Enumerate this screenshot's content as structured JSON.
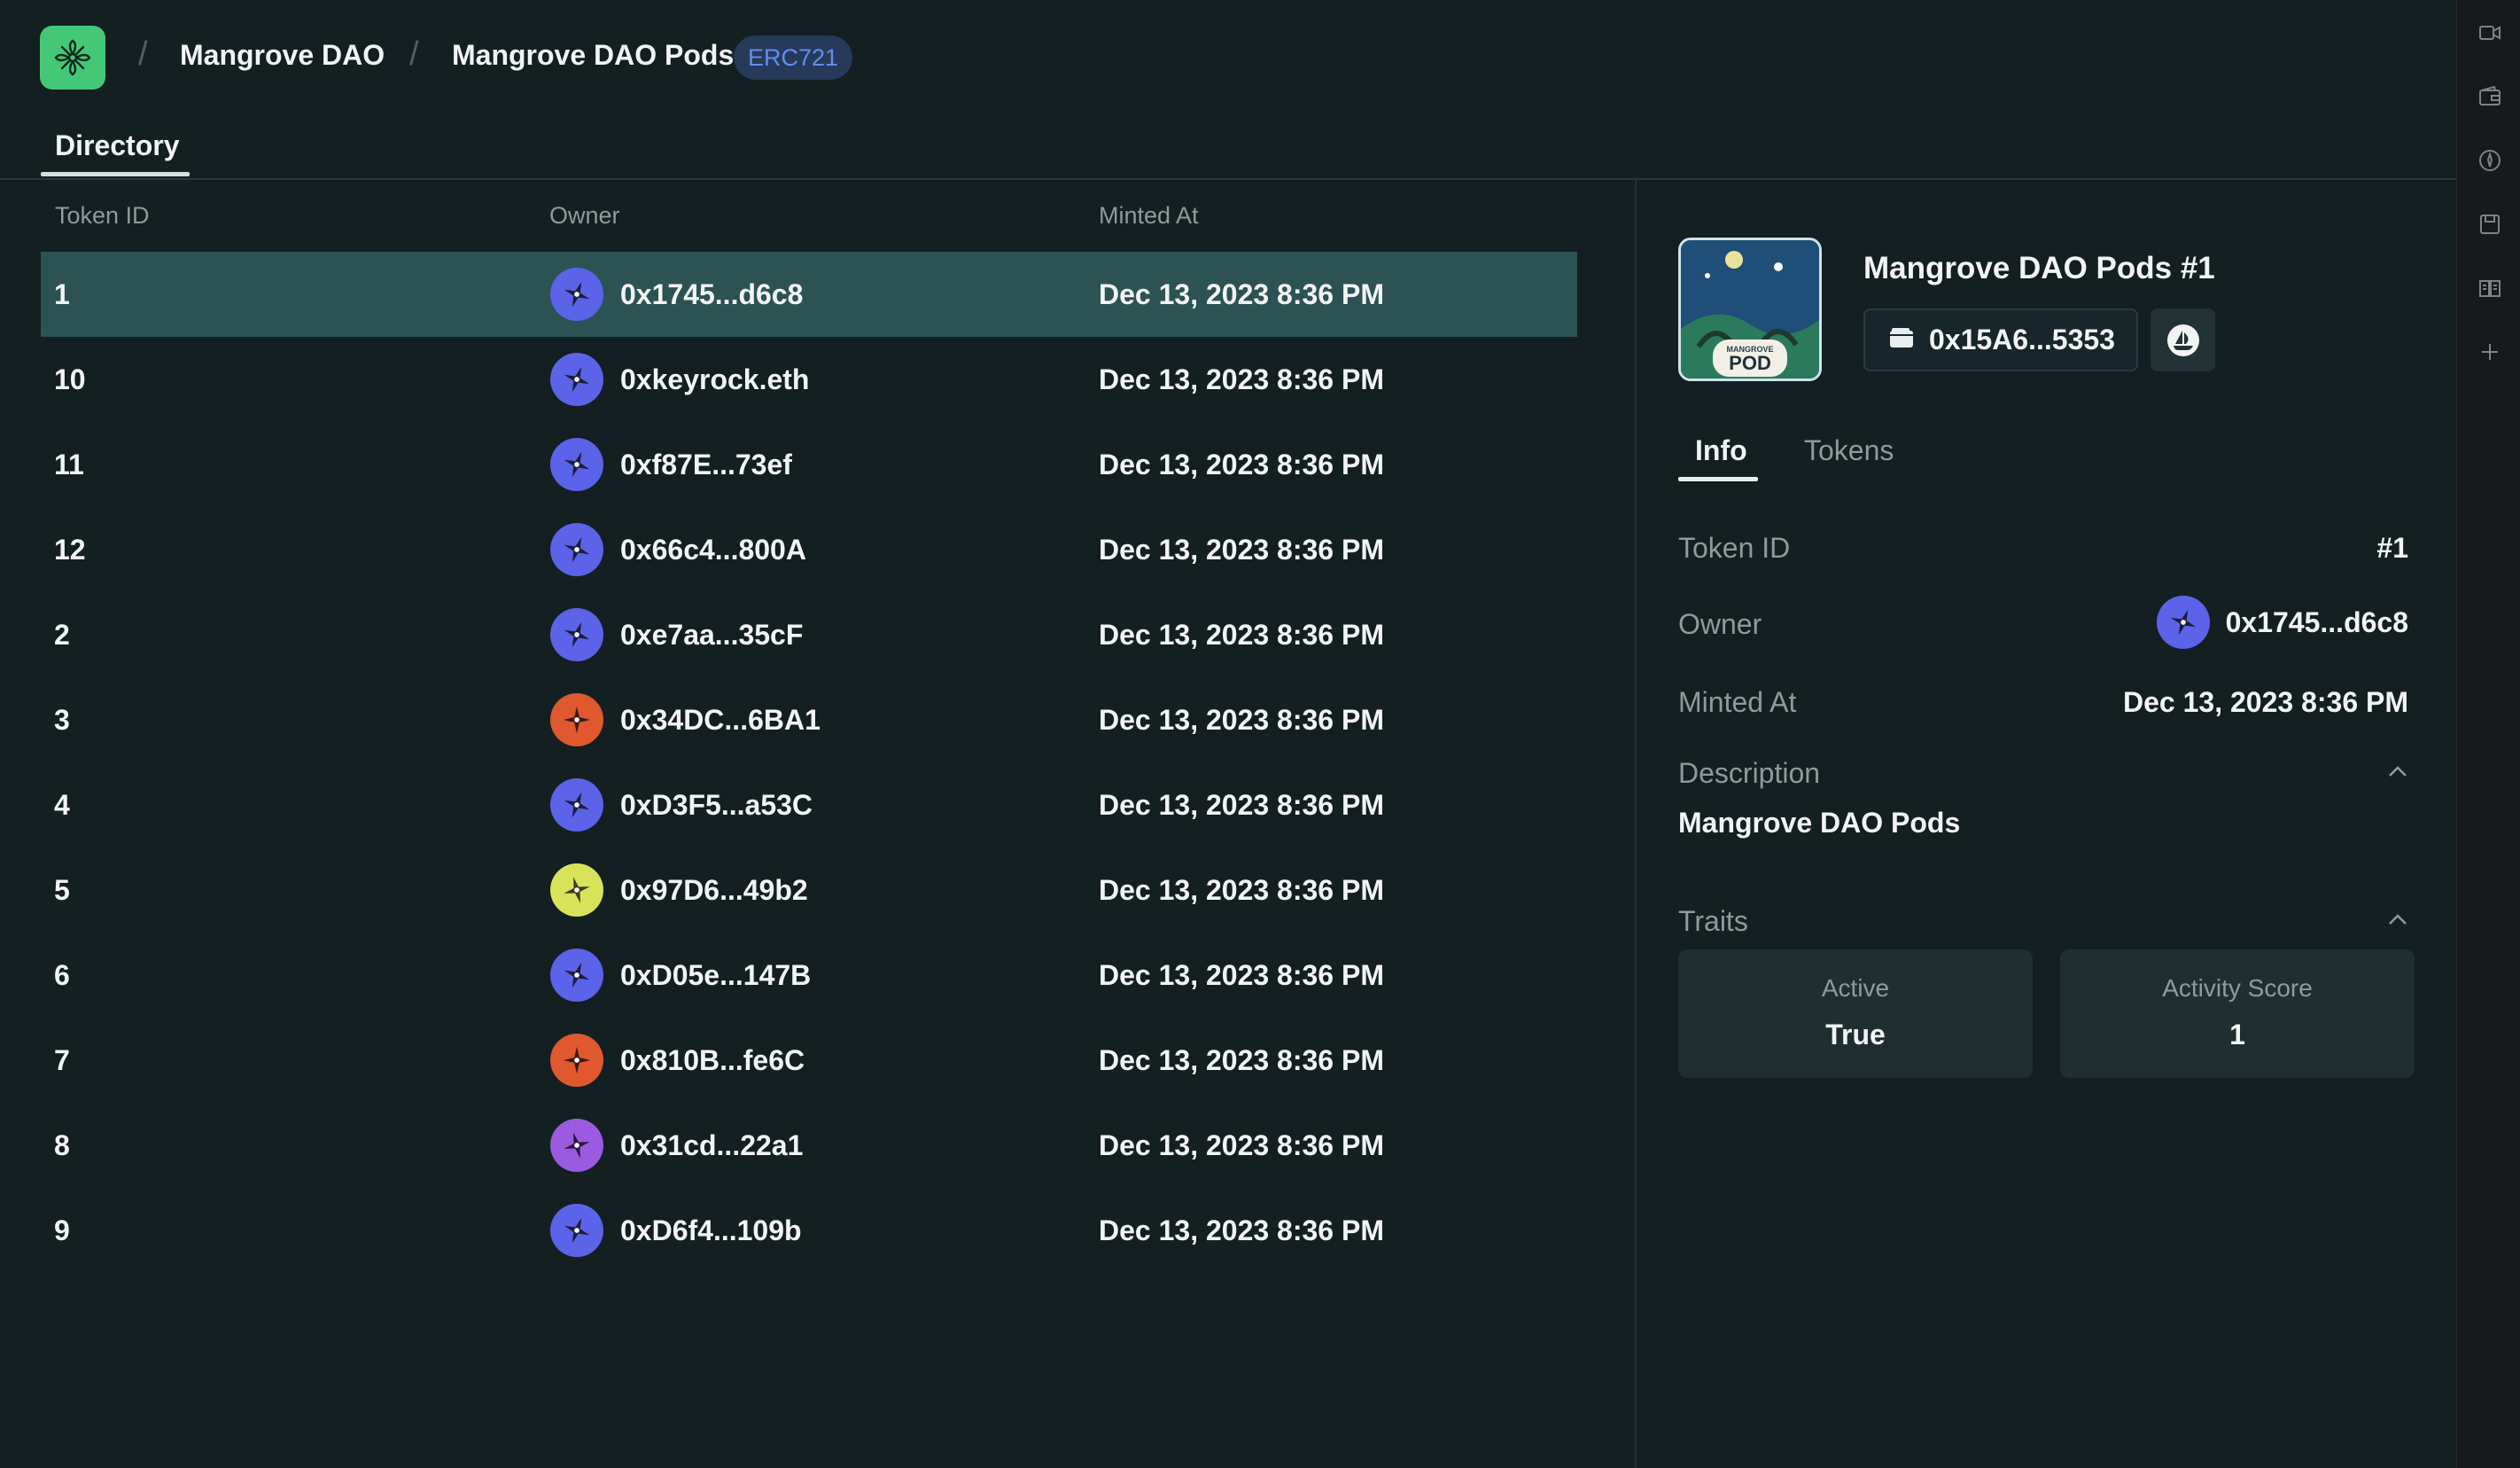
{
  "header": {
    "breadcrumb": [
      {
        "label": "Mangrove DAO"
      },
      {
        "label": "Mangrove DAO Pods"
      }
    ],
    "separator": "/",
    "badge": "ERC721",
    "tab": "Directory"
  },
  "table": {
    "columns": [
      "Token ID",
      "Owner",
      "Minted At"
    ],
    "rows": [
      {
        "id": "1",
        "owner": "0x1745...d6c8",
        "minted": "Dec 13, 2023 8:36 PM",
        "avatar": "blue"
      },
      {
        "id": "10",
        "owner": "0xkeyrock.eth",
        "minted": "Dec 13, 2023 8:36 PM",
        "avatar": "blue"
      },
      {
        "id": "11",
        "owner": "0xf87E...73ef",
        "minted": "Dec 13, 2023 8:36 PM",
        "avatar": "blue"
      },
      {
        "id": "12",
        "owner": "0x66c4...800A",
        "minted": "Dec 13, 2023 8:36 PM",
        "avatar": "blue"
      },
      {
        "id": "2",
        "owner": "0xe7aa...35cF",
        "minted": "Dec 13, 2023 8:36 PM",
        "avatar": "blue"
      },
      {
        "id": "3",
        "owner": "0x34DC...6BA1",
        "minted": "Dec 13, 2023 8:36 PM",
        "avatar": "orange"
      },
      {
        "id": "4",
        "owner": "0xD3F5...a53C",
        "minted": "Dec 13, 2023 8:36 PM",
        "avatar": "blue"
      },
      {
        "id": "5",
        "owner": "0x97D6...49b2",
        "minted": "Dec 13, 2023 8:36 PM",
        "avatar": "yellow"
      },
      {
        "id": "6",
        "owner": "0xD05e...147B",
        "minted": "Dec 13, 2023 8:36 PM",
        "avatar": "blue"
      },
      {
        "id": "7",
        "owner": "0x810B...fe6C",
        "minted": "Dec 13, 2023 8:36 PM",
        "avatar": "orange"
      },
      {
        "id": "8",
        "owner": "0x31cd...22a1",
        "minted": "Dec 13, 2023 8:36 PM",
        "avatar": "purple"
      },
      {
        "id": "9",
        "owner": "0xD6f4...109b",
        "minted": "Dec 13, 2023 8:36 PM",
        "avatar": "blue"
      }
    ]
  },
  "detail": {
    "title": "Mangrove DAO Pods #1",
    "thumb_small": "MANGROVE",
    "thumb_text": "POD",
    "contract_address": "0x15A6...5353",
    "tabs": [
      "Info",
      "Tokens"
    ],
    "token_id_label": "Token ID",
    "token_id": "#1",
    "owner_label": "Owner",
    "owner": "0x1745...d6c8",
    "minted_label": "Minted At",
    "minted": "Dec 13, 2023 8:36 PM",
    "description_label": "Description",
    "description": "Mangrove DAO Pods",
    "traits_label": "Traits",
    "traits": [
      {
        "name": "Active",
        "value": "True"
      },
      {
        "name": "Activity Score",
        "value": "1"
      }
    ]
  },
  "colors": {
    "accent": "#44c878",
    "selected_row": "#2c5254",
    "avatar_blue": "#5b63e8",
    "avatar_orange": "#e0582e",
    "avatar_yellow": "#d8e35a",
    "avatar_purple": "#9a5be0",
    "badge_text": "#5f8ff0"
  },
  "rail_icons": [
    "video-icon",
    "wallet-icon",
    "compass-icon",
    "save-icon",
    "book-icon",
    "plus-icon"
  ]
}
